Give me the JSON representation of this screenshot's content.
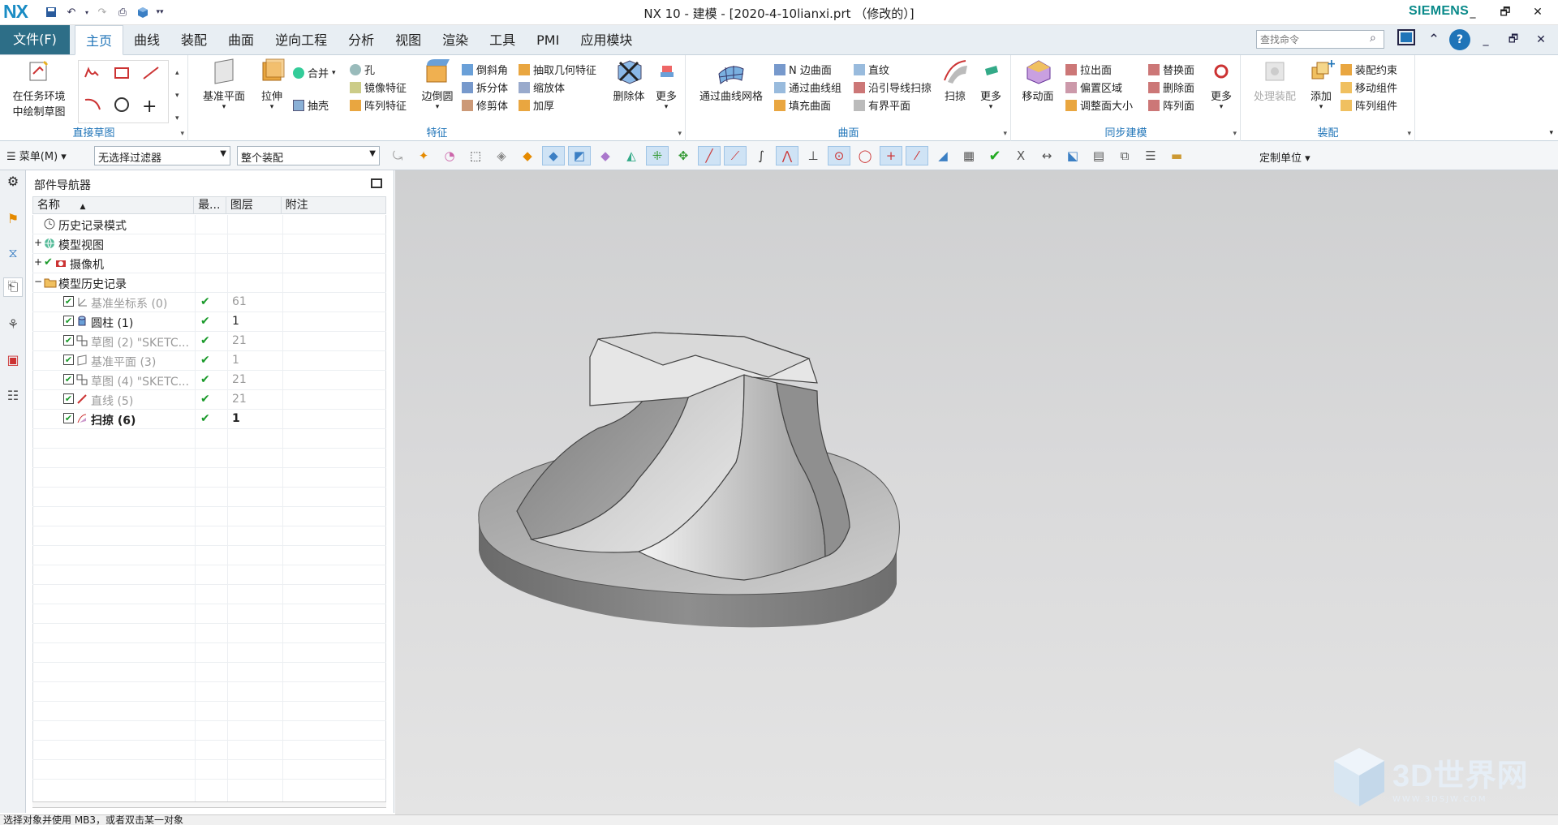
{
  "app": {
    "logo": "NX",
    "title": "NX 10 - 建模 - [2020-4-10lianxi.prt （修改的）]",
    "brand": "SIEMENS",
    "window_controls": [
      "_",
      "🗗",
      "✕"
    ]
  },
  "menu": {
    "file": "文件(F)",
    "tabs": [
      "主页",
      "曲线",
      "装配",
      "曲面",
      "逆向工程",
      "分析",
      "视图",
      "渲染",
      "工具",
      "PMI",
      "应用模块"
    ],
    "active_tab": "主页",
    "search_placeholder": "查找命令"
  },
  "ribbon": {
    "groups": {
      "sketch": {
        "label": "直接草图",
        "big": "在任务环境中绘制草图",
        "big_line1": "在任务环境",
        "big_line2": "中绘制草图"
      },
      "feature": {
        "label": "特征",
        "datum": "基准平面",
        "extrude": "拉伸",
        "merge": "合并",
        "hole": "孔",
        "shell": "抽壳",
        "mirror": "镜像特征",
        "pattern": "阵列特征",
        "edge_blend": "边倒圆",
        "chamfer": "倒斜角",
        "split": "拆分体",
        "trim": "修剪体",
        "extract": "抽取几何特征",
        "scale": "缩放体",
        "thicken": "加厚",
        "delete_body": "删除体",
        "more": "更多"
      },
      "surface": {
        "label": "曲面",
        "through_mesh": "通过曲线网格",
        "n_sided": "N 边曲面",
        "through_curves": "通过曲线组",
        "fill": "填充曲面",
        "ruled": "直纹",
        "sweep_guide": "沿引导线扫掠",
        "bounded": "有界平面",
        "sweep": "扫掠",
        "more": "更多"
      },
      "sync": {
        "label": "同步建模",
        "move_face": "移动面",
        "pull_face": "拉出面",
        "offset_region": "偏置区域",
        "resize_face": "调整面大小",
        "replace_face": "替换面",
        "delete_face": "删除面",
        "pattern_face": "阵列面",
        "more": "更多"
      },
      "assembly": {
        "label": "装配",
        "process": "处理装配",
        "add": "添加",
        "constraint": "装配约束",
        "move_comp": "移动组件",
        "pattern_comp": "阵列组件"
      }
    }
  },
  "toolbar": {
    "menu": "菜单(M)",
    "filter": "无选择过滤器",
    "scope": "整个装配",
    "units": "定制单位"
  },
  "navigator": {
    "title": "部件导航器",
    "columns": [
      "名称",
      "最...",
      "图层",
      "附注"
    ],
    "rows": [
      {
        "name": "历史记录模式",
        "indent": 0,
        "expand": "",
        "status": "",
        "layer": "",
        "icon": "clock",
        "style": "normal"
      },
      {
        "name": "模型视图",
        "indent": 0,
        "expand": "+",
        "status": "",
        "layer": "",
        "icon": "globe",
        "style": "normal"
      },
      {
        "name": "摄像机",
        "indent": 0,
        "expand": "+",
        "status": "",
        "layer": "",
        "icon": "camera",
        "style": "normal"
      },
      {
        "name": "模型历史记录",
        "indent": 0,
        "expand": "-",
        "status": "",
        "layer": "",
        "icon": "folder",
        "style": "normal"
      },
      {
        "name": "基准坐标系 (0)",
        "indent": 1,
        "expand": "",
        "status": "✔",
        "layer": "61",
        "icon": "csys",
        "style": "grey"
      },
      {
        "name": "圆柱 (1)",
        "indent": 1,
        "expand": "",
        "status": "✔",
        "layer": "1",
        "icon": "cyl",
        "style": "normal"
      },
      {
        "name": "草图 (2) \"SKETC...",
        "indent": 1,
        "expand": "",
        "status": "✔",
        "layer": "21",
        "icon": "sketch",
        "style": "grey"
      },
      {
        "name": "基准平面 (3)",
        "indent": 1,
        "expand": "",
        "status": "✔",
        "layer": "1",
        "icon": "plane",
        "style": "grey"
      },
      {
        "name": "草图 (4) \"SKETC...",
        "indent": 1,
        "expand": "",
        "status": "✔",
        "layer": "21",
        "icon": "sketch",
        "style": "grey"
      },
      {
        "name": "直线 (5)",
        "indent": 1,
        "expand": "",
        "status": "✔",
        "layer": "21",
        "icon": "line",
        "style": "grey"
      },
      {
        "name": "扫掠 (6)",
        "indent": 1,
        "expand": "",
        "status": "✔",
        "layer": "1",
        "icon": "sweep",
        "style": "bold"
      }
    ]
  },
  "status_bar": "选择对象并使用 MB3，或者双击某一对象",
  "watermark": {
    "text": "3D世界网",
    "url": "WWW.3DSJW.COM"
  }
}
